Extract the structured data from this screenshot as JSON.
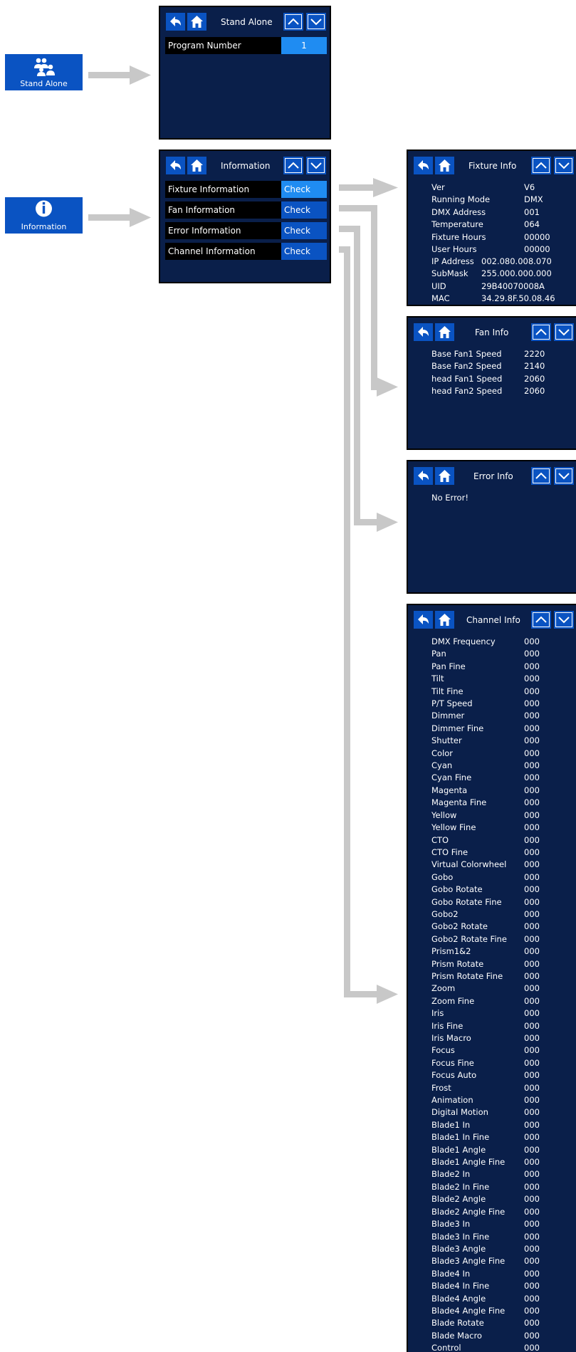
{
  "menu_buttons": {
    "stand_alone": {
      "label": "Stand Alone",
      "icon": "users-icon"
    },
    "information": {
      "label": "Information",
      "icon": "info-icon"
    }
  },
  "stand_alone_screen": {
    "title": "Stand Alone",
    "program_number_label": "Program Number",
    "program_number_value": "1"
  },
  "information_screen": {
    "title": "Information",
    "items": [
      {
        "label": "Fixture Information",
        "action": "Check"
      },
      {
        "label": "Fan Information",
        "action": "Check"
      },
      {
        "label": "Error Information",
        "action": "Check"
      },
      {
        "label": "Channel Information",
        "action": "Check"
      }
    ]
  },
  "fixture_info": {
    "title": "Fixture Info",
    "rows": [
      {
        "label": "Ver",
        "value": "V6"
      },
      {
        "label": "Running Mode",
        "value": "DMX"
      },
      {
        "label": "DMX Address",
        "value": "001"
      },
      {
        "label": "Temperature",
        "value": "064"
      },
      {
        "label": "Fixture Hours",
        "value": "00000"
      },
      {
        "label": "User Hours",
        "value": "00000"
      },
      {
        "label": "IP Address",
        "value": "002.080.008.070"
      },
      {
        "label": "SubMask",
        "value": "255.000.000.000"
      },
      {
        "label": "UID",
        "value": "29B40070008A"
      },
      {
        "label": "MAC",
        "value": "34.29.8F.50.08.46"
      }
    ]
  },
  "fan_info": {
    "title": "Fan Info",
    "rows": [
      {
        "label": "Base Fan1 Speed",
        "value": "2220"
      },
      {
        "label": "Base Fan2 Speed",
        "value": "2140"
      },
      {
        "label": "head Fan1 Speed",
        "value": "2060"
      },
      {
        "label": "head Fan2 Speed",
        "value": "2060"
      }
    ]
  },
  "error_info": {
    "title": "Error Info",
    "message": "No Error!"
  },
  "channel_info": {
    "title": "Channel Info",
    "channels": [
      {
        "label": "DMX Frequency",
        "value": "000"
      },
      {
        "label": "Pan",
        "value": "000"
      },
      {
        "label": "Pan Fine",
        "value": "000"
      },
      {
        "label": "Tilt",
        "value": "000"
      },
      {
        "label": "Tilt Fine",
        "value": "000"
      },
      {
        "label": "P/T Speed",
        "value": "000"
      },
      {
        "label": "Dimmer",
        "value": "000"
      },
      {
        "label": "Dimmer Fine",
        "value": "000"
      },
      {
        "label": "Shutter",
        "value": "000"
      },
      {
        "label": "Color",
        "value": "000"
      },
      {
        "label": "Cyan",
        "value": "000"
      },
      {
        "label": "Cyan Fine",
        "value": "000"
      },
      {
        "label": "Magenta",
        "value": "000"
      },
      {
        "label": "Magenta Fine",
        "value": "000"
      },
      {
        "label": "Yellow",
        "value": "000"
      },
      {
        "label": "Yellow Fine",
        "value": "000"
      },
      {
        "label": "CTO",
        "value": "000"
      },
      {
        "label": "CTO Fine",
        "value": "000"
      },
      {
        "label": "Virtual Colorwheel",
        "value": "000"
      },
      {
        "label": "Gobo",
        "value": "000"
      },
      {
        "label": "Gobo Rotate",
        "value": "000"
      },
      {
        "label": "Gobo Rotate Fine",
        "value": "000"
      },
      {
        "label": "Gobo2",
        "value": "000"
      },
      {
        "label": "Gobo2 Rotate",
        "value": "000"
      },
      {
        "label": "Gobo2 Rotate Fine",
        "value": "000"
      },
      {
        "label": "Prism1&2",
        "value": "000"
      },
      {
        "label": "Prism Rotate",
        "value": "000"
      },
      {
        "label": "Prism Rotate Fine",
        "value": "000"
      },
      {
        "label": "Zoom",
        "value": "000"
      },
      {
        "label": "Zoom Fine",
        "value": "000"
      },
      {
        "label": "Iris",
        "value": "000"
      },
      {
        "label": "Iris Fine",
        "value": "000"
      },
      {
        "label": "Iris Macro",
        "value": "000"
      },
      {
        "label": "Focus",
        "value": "000"
      },
      {
        "label": "Focus Fine",
        "value": "000"
      },
      {
        "label": "Focus Auto",
        "value": "000"
      },
      {
        "label": "Frost",
        "value": "000"
      },
      {
        "label": "Animation",
        "value": "000"
      },
      {
        "label": "Digital Motion",
        "value": "000"
      },
      {
        "label": "Blade1 In",
        "value": "000"
      },
      {
        "label": "Blade1 In Fine",
        "value": "000"
      },
      {
        "label": "Blade1 Angle",
        "value": "000"
      },
      {
        "label": "Blade1 Angle Fine",
        "value": "000"
      },
      {
        "label": "Blade2 In",
        "value": "000"
      },
      {
        "label": "Blade2 In Fine",
        "value": "000"
      },
      {
        "label": "Blade2 Angle",
        "value": "000"
      },
      {
        "label": "Blade2 Angle Fine",
        "value": "000"
      },
      {
        "label": "Blade3 In",
        "value": "000"
      },
      {
        "label": "Blade3 In Fine",
        "value": "000"
      },
      {
        "label": "Blade3 Angle",
        "value": "000"
      },
      {
        "label": "Blade3 Angle Fine",
        "value": "000"
      },
      {
        "label": "Blade4 In",
        "value": "000"
      },
      {
        "label": "Blade4 In Fine",
        "value": "000"
      },
      {
        "label": "Blade4 Angle",
        "value": "000"
      },
      {
        "label": "Blade4 Angle Fine",
        "value": "000"
      },
      {
        "label": "Blade Rotate",
        "value": "000"
      },
      {
        "label": "Blade Macro",
        "value": "000"
      },
      {
        "label": "Control",
        "value": "000"
      }
    ]
  },
  "colors": {
    "screen_bg": "#0a1f4a",
    "button_blue": "#0a53c2",
    "selected_blue": "#1f8cf2",
    "arrow_gray": "#c8c8c8"
  }
}
